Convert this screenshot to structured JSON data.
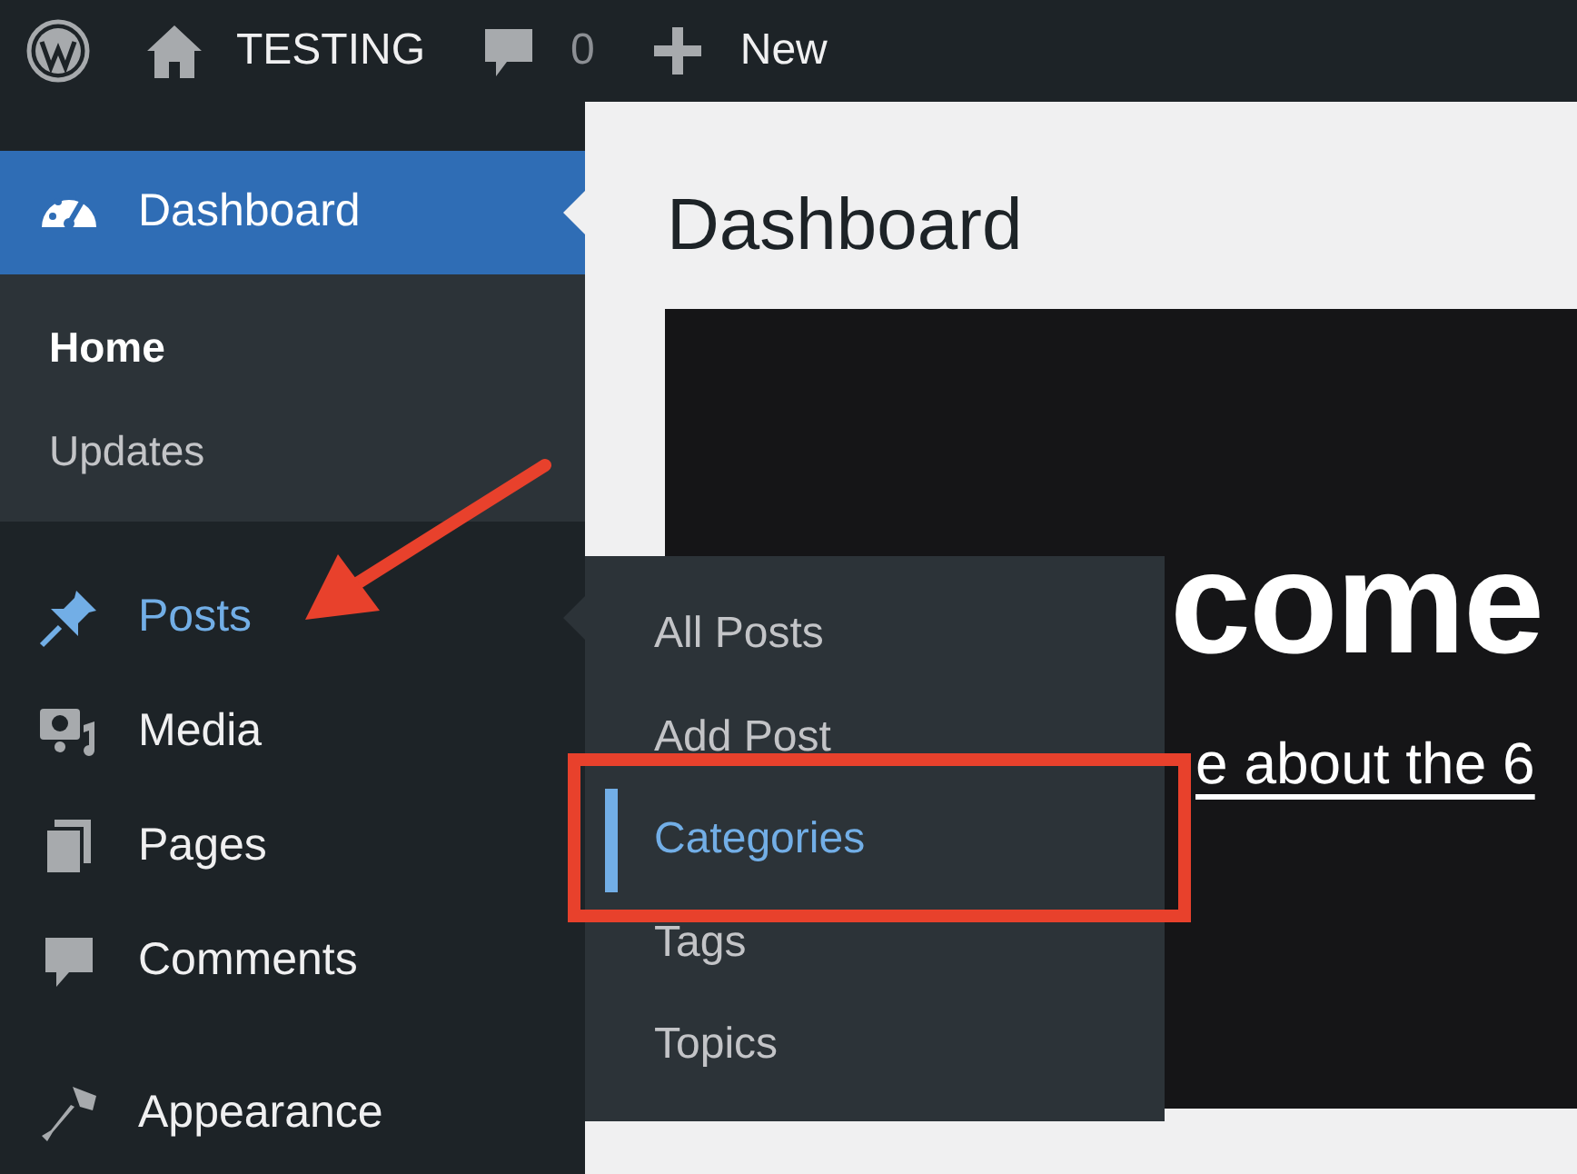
{
  "admin_bar": {
    "site_name": "TESTING",
    "comments_count": "0",
    "new_label": "New"
  },
  "sidebar": {
    "items": [
      {
        "label": "Dashboard",
        "selected": true,
        "open": false,
        "separated": false,
        "submenu": [
          {
            "label": "Home",
            "selected": true
          },
          {
            "label": "Updates",
            "selected": false
          }
        ]
      },
      {
        "label": "Posts",
        "selected": false,
        "open": true,
        "separated": true
      },
      {
        "label": "Media",
        "selected": false,
        "open": false,
        "separated": false
      },
      {
        "label": "Pages",
        "selected": false,
        "open": false,
        "separated": false
      },
      {
        "label": "Comments",
        "selected": false,
        "open": false,
        "separated": false
      },
      {
        "label": "Appearance",
        "selected": false,
        "open": false,
        "separated": true
      }
    ]
  },
  "flyout": {
    "items": [
      {
        "label": "All Posts",
        "selected": false
      },
      {
        "label": "Add Post",
        "selected": false
      },
      {
        "label": "Categories",
        "selected": true
      },
      {
        "label": "Tags",
        "selected": false
      },
      {
        "label": "Topics",
        "selected": false
      }
    ]
  },
  "page": {
    "title": "Dashboard",
    "welcome_heading": "come",
    "welcome_link": "e about the 6"
  }
}
